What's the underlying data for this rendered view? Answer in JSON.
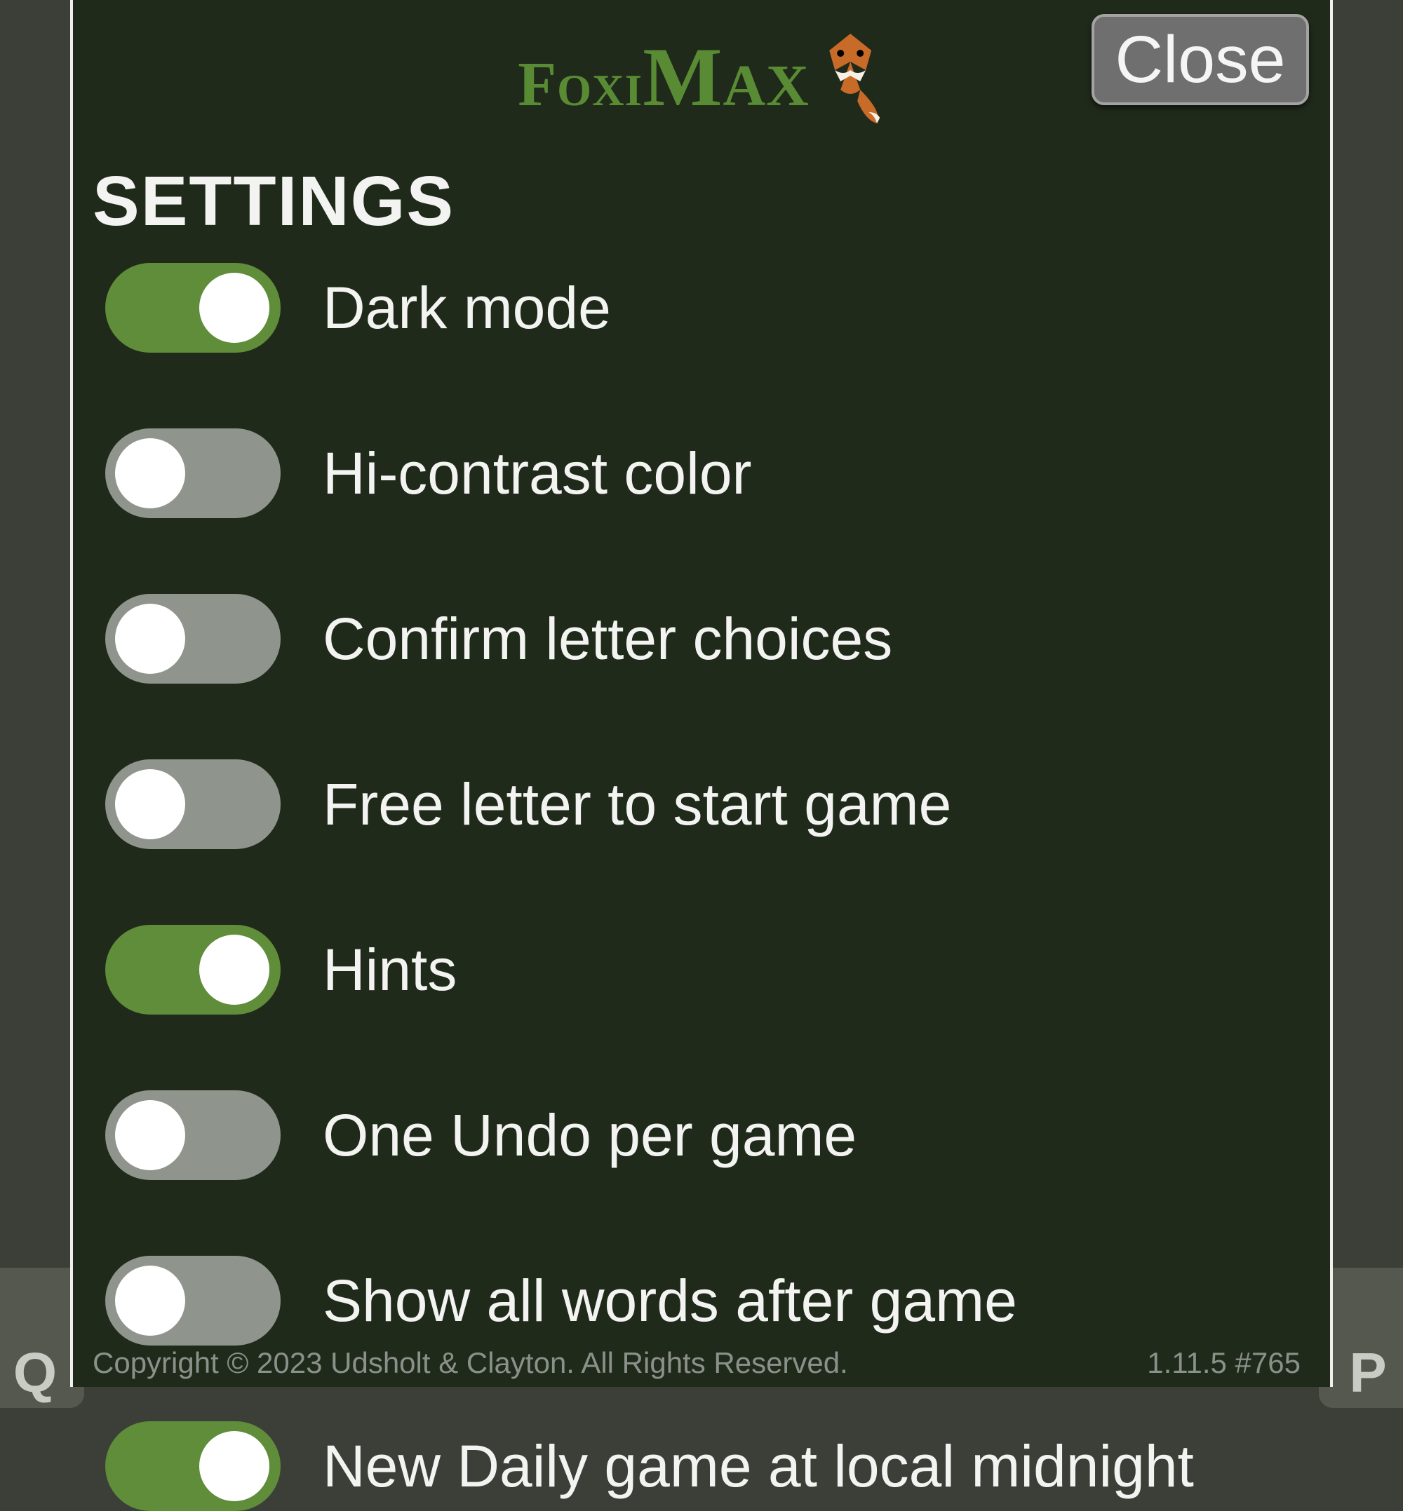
{
  "header": {
    "brand_prefix": "Foxi",
    "brand_emph": "Max",
    "close_label": "Close"
  },
  "title": "SETTINGS",
  "toggles": [
    {
      "id": "dark-mode",
      "label": "Dark mode",
      "on": true
    },
    {
      "id": "hi-contrast",
      "label": "Hi-contrast color",
      "on": false
    },
    {
      "id": "confirm-letters",
      "label": "Confirm letter choices",
      "on": false
    },
    {
      "id": "free-letter",
      "label": "Free letter to start game",
      "on": false
    },
    {
      "id": "hints",
      "label": "Hints",
      "on": true
    },
    {
      "id": "one-undo",
      "label": "One Undo per game",
      "on": false
    },
    {
      "id": "show-all-words",
      "label": "Show all words after game",
      "on": false
    },
    {
      "id": "daily-midnight",
      "label": "New Daily game at local midnight",
      "on": true
    }
  ],
  "footer": {
    "copyright": "Copyright © 2023 Udsholt & Clayton. All Rights Reserved.",
    "version": "1.11.5 #765"
  },
  "background": {
    "left_tile_char": "Q",
    "right_tile_char": "P"
  }
}
